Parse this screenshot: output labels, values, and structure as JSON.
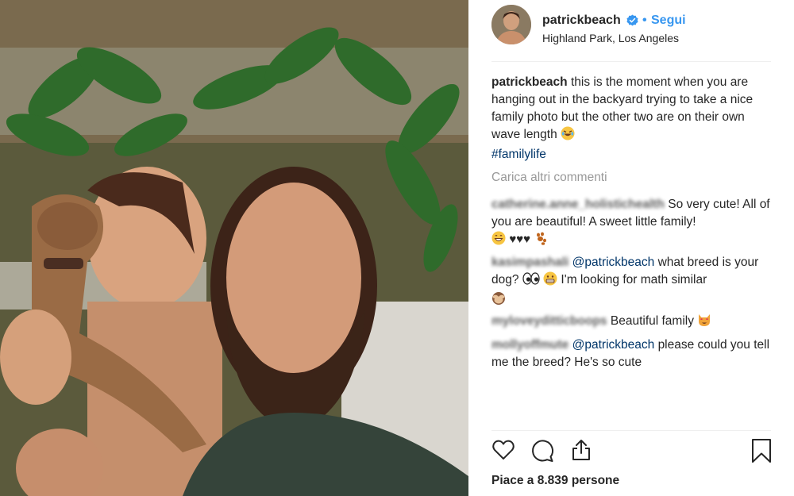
{
  "post": {
    "username": "patrickbeach",
    "follow_label": "Segui",
    "separator": "•",
    "location": "Highland Park, Los Angeles",
    "caption_text": "this is the moment when you are hanging out in the backyard trying to take a nice family photo but the other two are on their own wave length",
    "caption_hashtag": "#familylife",
    "load_more_label": "Carica altri commenti",
    "likes_label": "Piace a 8.839 persone"
  },
  "comments": [
    {
      "username": "catherine.anne_holistichealth",
      "mention": "",
      "text": "So very cute! All of you are beautiful! A sweet little family!"
    },
    {
      "username": "kasimpashali",
      "mention": "@patrickbeach",
      "text": "what breed is your dog?",
      "text2": "I'm looking for math similar"
    },
    {
      "username": "myloveyditticboops",
      "mention": "",
      "text": "Beautiful family"
    },
    {
      "username": "mollyoffmute",
      "mention": "@patrickbeach",
      "text": "please could you tell me the breed? He's so cute"
    }
  ],
  "icons": {
    "verified": "verified-badge-icon",
    "like": "heart-icon",
    "comment": "comment-bubble-icon",
    "share": "share-icon",
    "save": "bookmark-icon"
  },
  "colors": {
    "link": "#3897f0",
    "hashtag": "#003569",
    "muted": "#999999",
    "text": "#262626"
  }
}
